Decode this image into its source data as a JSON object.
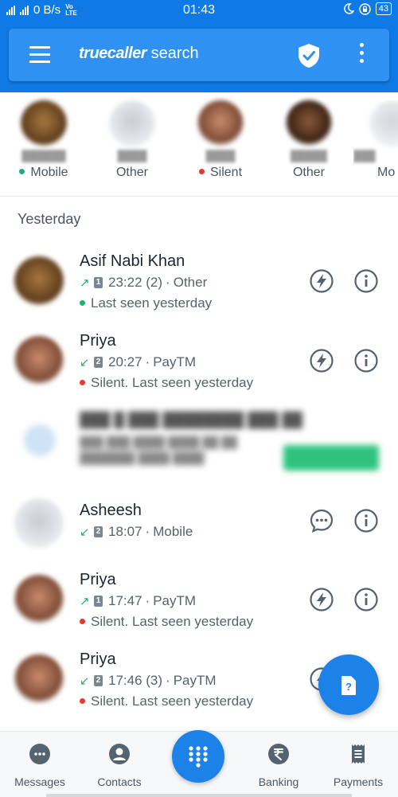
{
  "status_bar": {
    "net_speed": "0 B/s",
    "volte": "Vo",
    "lte": "LTE",
    "time": "01:43",
    "battery": "43"
  },
  "header": {
    "brand": "truecaller",
    "title": "search"
  },
  "favorites": [
    {
      "label": "Mobile",
      "dot_color": "#1fb079"
    },
    {
      "label": "Other",
      "dot_color": ""
    },
    {
      "label": "Silent",
      "dot_color": "#e53935"
    },
    {
      "label": "Other",
      "dot_color": ""
    },
    {
      "label": "Mo",
      "dot_color": ""
    }
  ],
  "section_title": "Yesterday",
  "calls": [
    {
      "name": "Asif Nabi Khan",
      "direction": "outgoing",
      "sim": "1",
      "time": "23:22 (2)",
      "type": "Other",
      "status": "Last seen yesterday",
      "status_color": "#1fb079",
      "action_icon": "flash-icon"
    },
    {
      "name": "Priya",
      "direction": "incoming",
      "sim": "2",
      "time": "20:27",
      "type": "PayTM",
      "status": "Silent. Last seen yesterday",
      "status_color": "#e53935",
      "action_icon": "flash-icon"
    },
    {
      "name": "Asheesh",
      "direction": "incoming",
      "sim": "2",
      "time": "18:07",
      "type": "Mobile",
      "status": "",
      "status_color": "",
      "action_icon": "message-icon"
    },
    {
      "name": "Priya",
      "direction": "outgoing",
      "sim": "1",
      "time": "17:47",
      "type": "PayTM",
      "status": "Silent. Last seen yesterday",
      "status_color": "#e53935",
      "action_icon": "flash-icon"
    },
    {
      "name": "Priya",
      "direction": "incoming",
      "sim": "2",
      "time": "17:46 (3)",
      "type": "PayTM",
      "status": "Silent. Last seen yesterday",
      "status_color": "#e53935",
      "action_icon": "flash-icon"
    }
  ],
  "bottom_nav": {
    "messages": "Messages",
    "contacts": "Contacts",
    "banking": "Banking",
    "payments": "Payments"
  },
  "colors": {
    "primary": "#0f7ae5",
    "accent": "#1d82e8",
    "online": "#1fb079",
    "silent": "#e53935",
    "icon_grey": "#556270"
  }
}
